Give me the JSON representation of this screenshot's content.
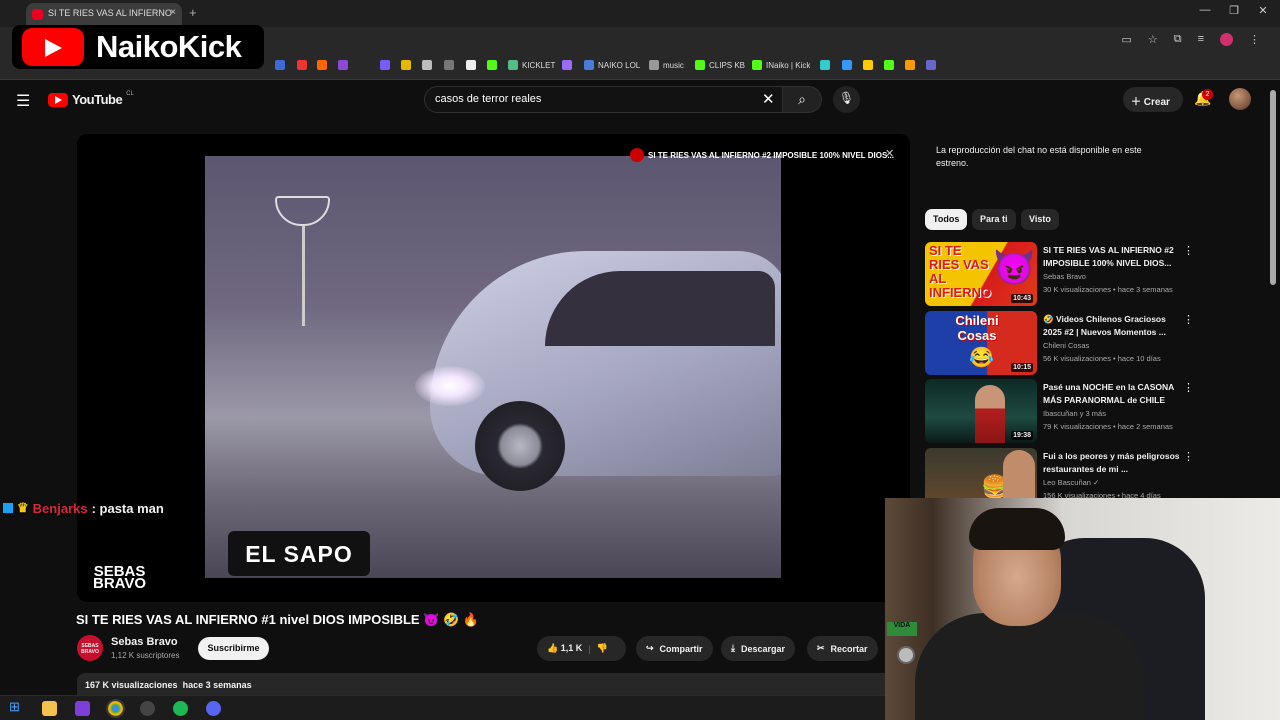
{
  "browser": {
    "tab_title": "SI TE RIES VAS AL INFIERNO",
    "tab_close": "×",
    "new_tab": "+",
    "window_controls": [
      "—",
      "❐",
      "✕"
    ],
    "bookmarks": [
      {
        "label": "KICKLET",
        "color": "#5b8"
      },
      {
        "label": "NAIKO LOL",
        "color": "#4a7bd6"
      },
      {
        "label": "music",
        "color": "#999"
      },
      {
        "label": "CLIPS KB",
        "color": "#53fc18"
      },
      {
        "label": "INaiko | Kick",
        "color": "#53fc18"
      }
    ]
  },
  "overlay_logo": {
    "text": "NaikoKick"
  },
  "youtube": {
    "logo_text": "YouTube",
    "region": "CL",
    "search_value": "casos de terror reales",
    "search_clear": "✕",
    "create_label": "Crear",
    "notification_count": "2"
  },
  "player": {
    "caption": "EL SAPO",
    "miniplayer_title": "SI TE RIES VAS AL INFIERNO #2 IMPOSIBLE 100% NIVEL DIOS...",
    "miniplayer_close": "✕",
    "watermark_line1": "SEBAS",
    "watermark_line2": "BRAVO"
  },
  "chat_overlay": {
    "user": "Benjarks",
    "message": ": pasta man"
  },
  "video": {
    "title": "SI TE RIES VAS AL INFIERNO #1 nivel DIOS IMPOSIBLE 😈 🤣 🔥",
    "channel": "Sebas Bravo",
    "channel_avatar_text": "SEBAS BRAVO",
    "subscribers": "1,12 K suscriptores",
    "subscribe_label": "Suscribirme",
    "likes": "1,1 K",
    "share_label": "Compartir",
    "download_label": "Descargar",
    "clip_label": "Recortar",
    "views": "167 K visualizaciones",
    "date": "hace 3 semanas"
  },
  "sidebar": {
    "chat_message": "La reproducción del chat no está disponible en este estreno.",
    "chips": [
      "Todos",
      "Para ti",
      "Visto"
    ],
    "recommendations": [
      {
        "title": "SI TE RIES VAS AL INFIERNO #2 IMPOSIBLE 100% NIVEL DIOS...",
        "channel": "Sebas Bravo",
        "meta": "30 K visualizaciones • hace 3 semanas",
        "duration": "10:43",
        "thumb_text": "SI TE RIES VAS AL INFIERNO",
        "thumb_color": "#e8b400"
      },
      {
        "title": "🤣 Videos Chilenos Graciosos 2025 #2 | Nuevos Momentos ...",
        "channel": "Chileni Cosas",
        "meta": "56 K visualizaciones • hace 10 días",
        "duration": "10:15",
        "thumb_text": "Chileni Cosas",
        "thumb_color": "#1f3fa8"
      },
      {
        "title": "Pasé una NOCHE en la CASONA MÁS PARANORMAL de CHILE",
        "channel": "Ibascuñan y 3 más",
        "meta": "79 K visualizaciones • hace 2 semanas",
        "duration": "19:38",
        "thumb_text": "",
        "thumb_color": "#1d4a40"
      },
      {
        "title": "Fui a los peores y más peligrosos restaurantes de mi ...",
        "channel": "Leo Bascuñan ✓",
        "meta": "156 K visualizaciones • hace 4 días",
        "duration": "",
        "thumb_text": "",
        "thumb_color": "#6a4a2c"
      }
    ]
  },
  "webcam": {
    "plant_text": "VIDA"
  }
}
